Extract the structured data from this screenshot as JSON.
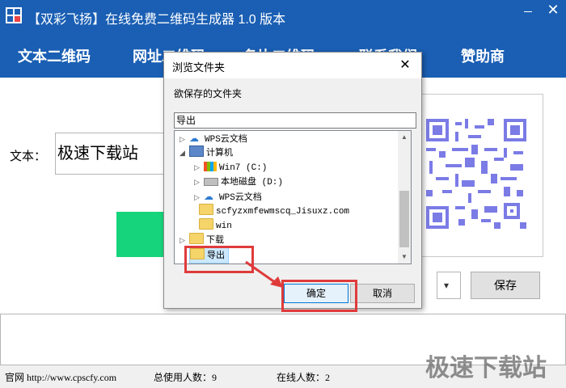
{
  "window": {
    "title": "【双彩飞扬】在线免费二维码生成器 1.0 版本",
    "close_glyph": "✕"
  },
  "nav": {
    "tabs": [
      "文本二维码",
      "网址二维码",
      "名片二维码",
      "联系我们",
      "赞助商"
    ]
  },
  "main": {
    "text_label": "文本：",
    "text_value": "极速下载站",
    "save_label": "保存",
    "qr_color": "#7b7be6",
    "accent_green": "#16d47b"
  },
  "dialog": {
    "title": "浏览文件夹",
    "prompt": "欲保存的文件夹",
    "path_value": "导出",
    "tree": [
      {
        "label": "WPS云文档",
        "icon": "cloud-icon"
      },
      {
        "label": "计算机",
        "icon": "computer-icon"
      },
      {
        "label": "Win7 (C:)",
        "icon": "windows-drive-icon"
      },
      {
        "label": "本地磁盘 (D:)",
        "icon": "drive-icon"
      },
      {
        "label": "WPS云文档",
        "icon": "cloud-icon"
      },
      {
        "label": "scfyzxmfewmscq_Jisuxz.com",
        "icon": "folder-icon"
      },
      {
        "label": "win",
        "icon": "folder-icon"
      },
      {
        "label": "下载",
        "icon": "folder-icon"
      },
      {
        "label": "导出",
        "icon": "folder-icon"
      }
    ],
    "ok_label": "确定",
    "cancel_label": "取消"
  },
  "status": {
    "website": "官网 http://www.cpscfy.com",
    "total_users": "总使用人数：9",
    "online_users": "在线人数：2"
  },
  "watermark": "极速下载站"
}
